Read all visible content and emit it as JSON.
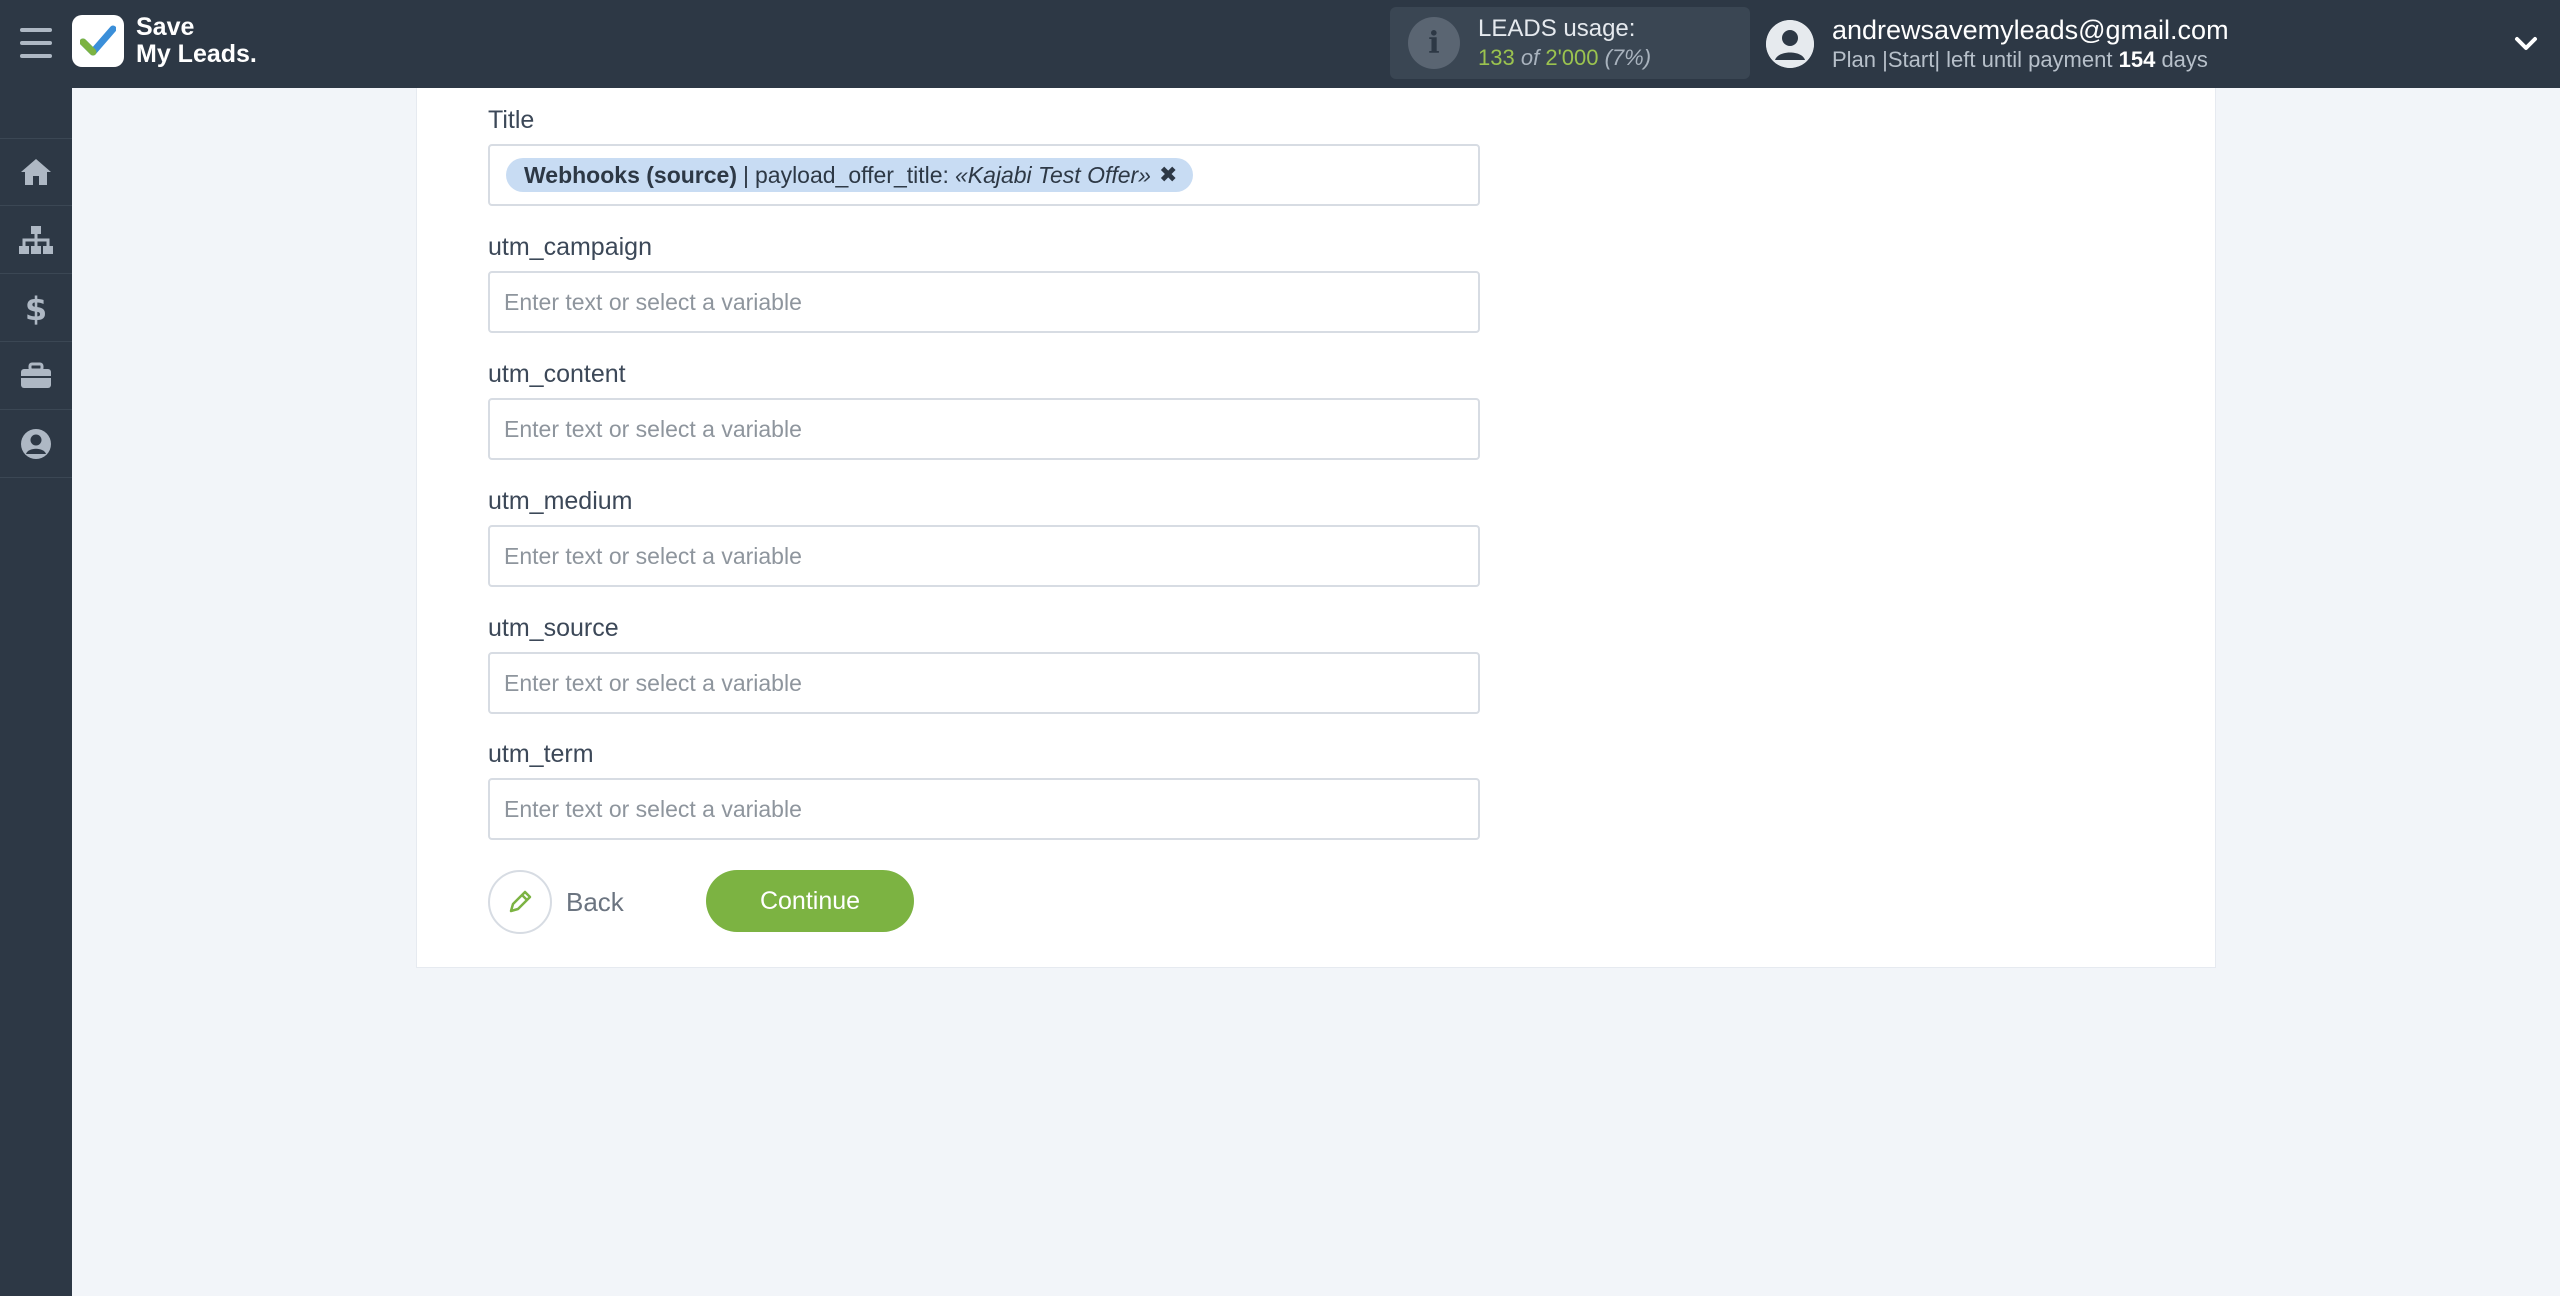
{
  "header": {
    "logo_line1": "Save",
    "logo_line2": "My Leads.",
    "usage": {
      "title": "LEADS usage:",
      "used": "133",
      "of": "of",
      "total": "2'000",
      "percent": "(7%)"
    },
    "account": {
      "email": "andrewsavemyleads@gmail.com",
      "plan_prefix": "Plan |Start| left until payment",
      "days_value": "154",
      "days_suffix": "days"
    }
  },
  "sidebar": {
    "items": [
      {
        "icon": "home-icon"
      },
      {
        "icon": "sitemap-icon"
      },
      {
        "icon": "dollar-icon"
      },
      {
        "icon": "briefcase-icon"
      },
      {
        "icon": "user-circle-icon"
      }
    ]
  },
  "form": {
    "title": {
      "label": "Title",
      "tag_source": "Webhooks (source)",
      "tag_separator": "|",
      "tag_field": "payload_offer_title:",
      "tag_value": "«Kajabi Test Offer»",
      "tag_close": "✖"
    },
    "fields": [
      {
        "label": "utm_campaign",
        "placeholder": "Enter text or select a variable",
        "value": ""
      },
      {
        "label": "utm_content",
        "placeholder": "Enter text or select a variable",
        "value": ""
      },
      {
        "label": "utm_medium",
        "placeholder": "Enter text or select a variable",
        "value": ""
      },
      {
        "label": "utm_source",
        "placeholder": "Enter text or select a variable",
        "value": ""
      },
      {
        "label": "utm_term",
        "placeholder": "Enter text or select a variable",
        "value": ""
      }
    ],
    "back_label": "Back",
    "continue_label": "Continue"
  },
  "colors": {
    "header_bg": "#2d3845",
    "accent_green": "#7cb342",
    "tag_bg": "#c8dcf3"
  }
}
